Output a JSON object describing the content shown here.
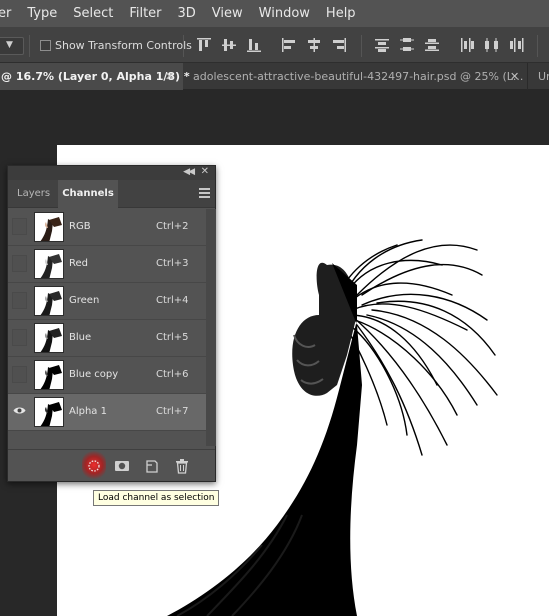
{
  "menubar": {
    "items": [
      "er",
      "Type",
      "Select",
      "Filter",
      "3D",
      "View",
      "Window",
      "Help"
    ]
  },
  "options_bar": {
    "tool_dropdown_icon": "chevron-down-icon",
    "show_transform_controls": {
      "label": "Show Transform Controls",
      "checked": false
    }
  },
  "document_tabs": [
    {
      "label": "@ 16.7% (Layer 0, Alpha 1/8) *",
      "active": true
    },
    {
      "label": "adolescent-attractive-beautiful-432497-hair.psd @ 25% (L...",
      "active": false
    },
    {
      "label": "Ur",
      "active": false
    }
  ],
  "panel": {
    "tabs": [
      {
        "label": "Layers",
        "active": false
      },
      {
        "label": "Channels",
        "active": true
      }
    ],
    "channels": [
      {
        "name": "RGB",
        "shortcut": "Ctrl+2",
        "visible": false,
        "selected": false
      },
      {
        "name": "Red",
        "shortcut": "Ctrl+3",
        "visible": false,
        "selected": false
      },
      {
        "name": "Green",
        "shortcut": "Ctrl+4",
        "visible": false,
        "selected": false
      },
      {
        "name": "Blue",
        "shortcut": "Ctrl+5",
        "visible": false,
        "selected": false
      },
      {
        "name": "Blue copy",
        "shortcut": "Ctrl+6",
        "visible": false,
        "selected": false
      },
      {
        "name": "Alpha 1",
        "shortcut": "Ctrl+7",
        "visible": true,
        "selected": true
      }
    ],
    "footer_icons": [
      "load-channel-as-selection-icon",
      "save-selection-as-channel-icon",
      "new-channel-icon",
      "trash-icon"
    ]
  },
  "tooltip": {
    "text": "Load channel as selection"
  },
  "colors": {
    "menubar_bg": "#535353",
    "optionsbar_bg": "#424242",
    "canvas_bg": "#282828",
    "panel_bg": "#535353",
    "selected_row": "#686868",
    "highlight_glow": "#ff2020",
    "tooltip_bg": "#ffffe1"
  }
}
